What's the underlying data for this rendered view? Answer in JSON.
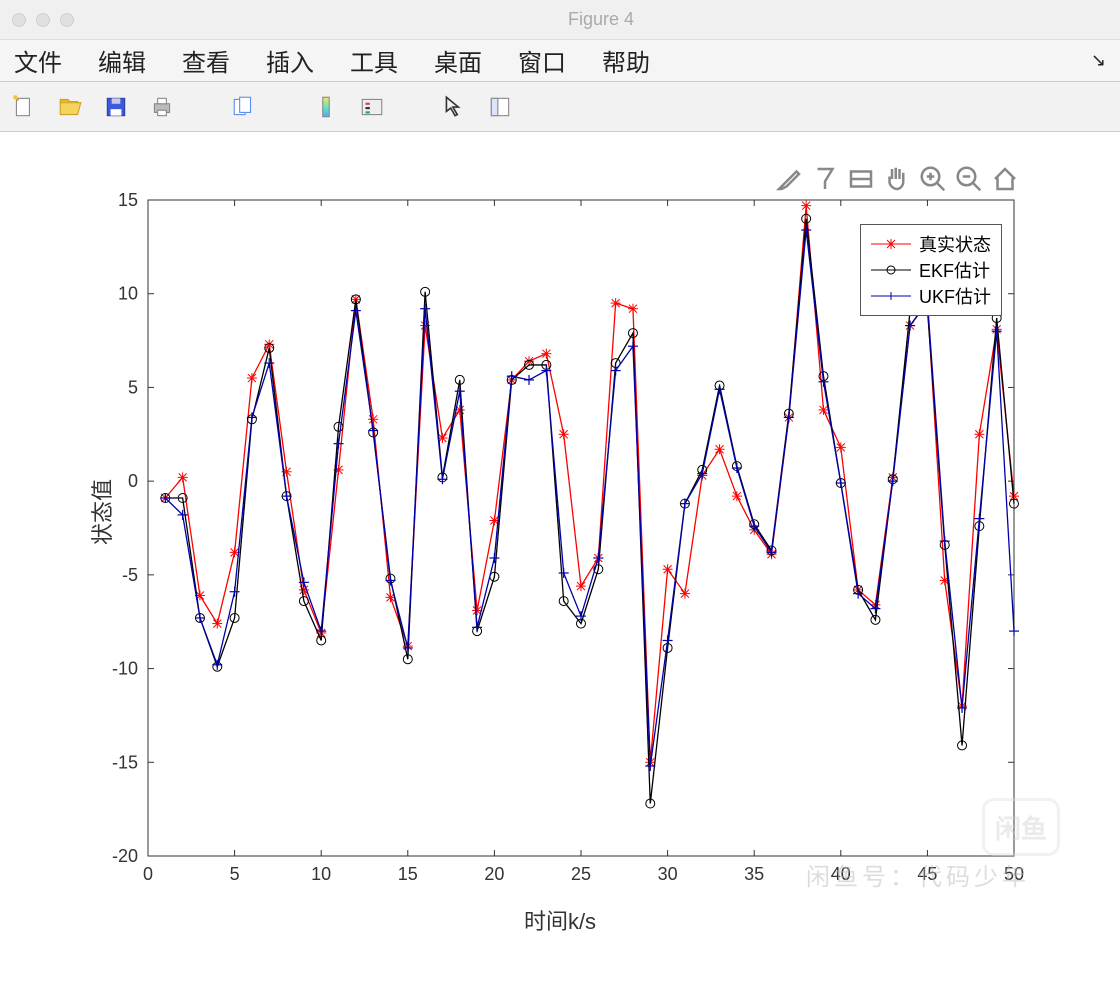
{
  "window": {
    "title": "Figure 4"
  },
  "menu": {
    "items": [
      "文件",
      "编辑",
      "查看",
      "插入",
      "工具",
      "桌面",
      "窗口",
      "帮助"
    ]
  },
  "toolbar_icons": [
    "new-file",
    "open",
    "save",
    "print",
    "page-setup",
    "colorbar",
    "legend",
    "arrow",
    "panel"
  ],
  "axes_toolbar_icons": [
    "brush",
    "data-cursor",
    "link-axes",
    "pan",
    "zoom-in",
    "zoom-out",
    "home"
  ],
  "chart_data": {
    "type": "line",
    "xlabel": "时间k/s",
    "ylabel": "状态值",
    "xlim": [
      0,
      50
    ],
    "ylim": [
      -20,
      15
    ],
    "xticks": [
      0,
      5,
      10,
      15,
      20,
      25,
      30,
      35,
      40,
      45,
      50
    ],
    "yticks": [
      -20,
      -15,
      -10,
      -5,
      0,
      5,
      10,
      15
    ],
    "x": [
      1,
      2,
      3,
      4,
      5,
      6,
      7,
      8,
      9,
      10,
      11,
      12,
      13,
      14,
      15,
      16,
      17,
      18,
      19,
      20,
      21,
      22,
      23,
      24,
      25,
      26,
      27,
      28,
      29,
      30,
      31,
      32,
      33,
      34,
      35,
      36,
      37,
      38,
      39,
      40,
      41,
      42,
      43,
      44,
      45,
      46,
      47,
      48,
      49,
      50
    ],
    "series": [
      {
        "name": "真实状态",
        "color": "#ff0000",
        "marker": "star",
        "values": [
          -0.9,
          0.2,
          -6.1,
          -7.6,
          -3.8,
          5.5,
          7.3,
          0.5,
          -5.8,
          -8.1,
          0.6,
          9.7,
          3.3,
          -6.2,
          -8.8,
          8.3,
          2.3,
          3.8,
          -6.9,
          -2.1,
          5.4,
          6.4,
          6.8,
          2.5,
          -5.6,
          -4.1,
          9.5,
          9.2,
          -15.0,
          -4.7,
          -6.0,
          0.3,
          1.7,
          -0.8,
          -2.6,
          -3.9,
          3.4,
          14.7,
          3.8,
          1.8,
          -5.8,
          -6.6,
          0.2,
          8.3,
          9.5,
          -5.3,
          -12.0,
          2.5,
          8.1,
          -0.8
        ]
      },
      {
        "name": "EKF估计",
        "color": "#000000",
        "marker": "circle",
        "values": [
          -0.9,
          -0.9,
          -7.3,
          -9.9,
          -7.3,
          3.3,
          7.1,
          -0.8,
          -6.4,
          -8.5,
          2.9,
          9.7,
          2.6,
          -5.2,
          -9.5,
          10.1,
          0.2,
          5.4,
          -8.0,
          -5.1,
          5.4,
          6.2,
          6.2,
          -6.4,
          -7.6,
          -4.7,
          6.3,
          7.9,
          -17.2,
          -8.9,
          -1.2,
          0.6,
          5.1,
          0.8,
          -2.3,
          -3.7,
          3.6,
          14.0,
          5.6,
          -0.1,
          -5.8,
          -7.4,
          0.1,
          9.1,
          9.2,
          -3.4,
          -14.1,
          -2.4,
          8.7,
          -1.2
        ]
      },
      {
        "name": "UKF估计",
        "color": "#0000aa",
        "marker": "plus",
        "values": [
          -0.9,
          -1.8,
          -7.3,
          -9.8,
          -5.9,
          3.4,
          6.3,
          -0.8,
          -5.4,
          -8.0,
          2.0,
          9.1,
          2.7,
          -5.3,
          -8.9,
          9.2,
          0.1,
          4.8,
          -7.8,
          -4.1,
          5.6,
          5.4,
          5.9,
          -4.9,
          -7.2,
          -4.1,
          5.9,
          7.2,
          -15.2,
          -8.5,
          -1.2,
          0.4,
          4.9,
          0.7,
          -2.4,
          -3.8,
          3.4,
          13.4,
          5.3,
          -0.1,
          -6.0,
          -6.8,
          0.0,
          8.3,
          9.6,
          -3.2,
          -12.1,
          -2.0,
          8.0,
          -8.0
        ]
      }
    ]
  },
  "legend": {
    "items": [
      "真实状态",
      "EKF估计",
      "UKF估计"
    ]
  },
  "watermark": {
    "box": "闲鱼",
    "text": "闲鱼号：代码少年"
  }
}
